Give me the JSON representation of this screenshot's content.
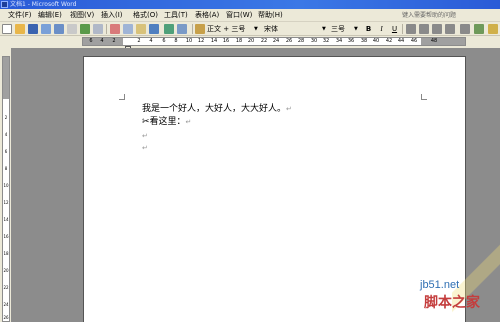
{
  "window": {
    "title": "文档1 - Microsoft Word"
  },
  "menu": {
    "items": [
      "文件(F)",
      "编辑(E)",
      "视图(V)",
      "插入(I)",
      "格式(O)",
      "工具(T)",
      "表格(A)",
      "窗口(W)",
      "帮助(H)"
    ],
    "help_placeholder": "键入需要帮助的问题"
  },
  "toolbar": {
    "style_value": "正文 + 三号",
    "font_value": "宋体",
    "size_value": "三号",
    "bold": "B",
    "italic": "I",
    "underline": "U"
  },
  "ruler": {
    "ticks": [
      "6",
      "4",
      "2",
      "2",
      "4",
      "6",
      "8",
      "10",
      "12",
      "14",
      "16",
      "18",
      "20",
      "22",
      "24",
      "26",
      "28",
      "30",
      "32",
      "34",
      "36",
      "38",
      "40",
      "42",
      "44",
      "46",
      "48"
    ]
  },
  "vruler": {
    "ticks": [
      "2",
      "4",
      "6",
      "8",
      "10",
      "12",
      "14",
      "16",
      "18",
      "20",
      "22",
      "24",
      "26"
    ]
  },
  "document": {
    "line1": "我是一个好人，大好人，大大好人。",
    "line2": "✂看这里：",
    "mark": "↵"
  },
  "watermark": {
    "site": "jb51.net",
    "name": "脚本之家"
  },
  "colors": {
    "titlebar": "#2a5bd7",
    "chrome": "#ece9d8",
    "workspace": "#8c8c8c"
  }
}
